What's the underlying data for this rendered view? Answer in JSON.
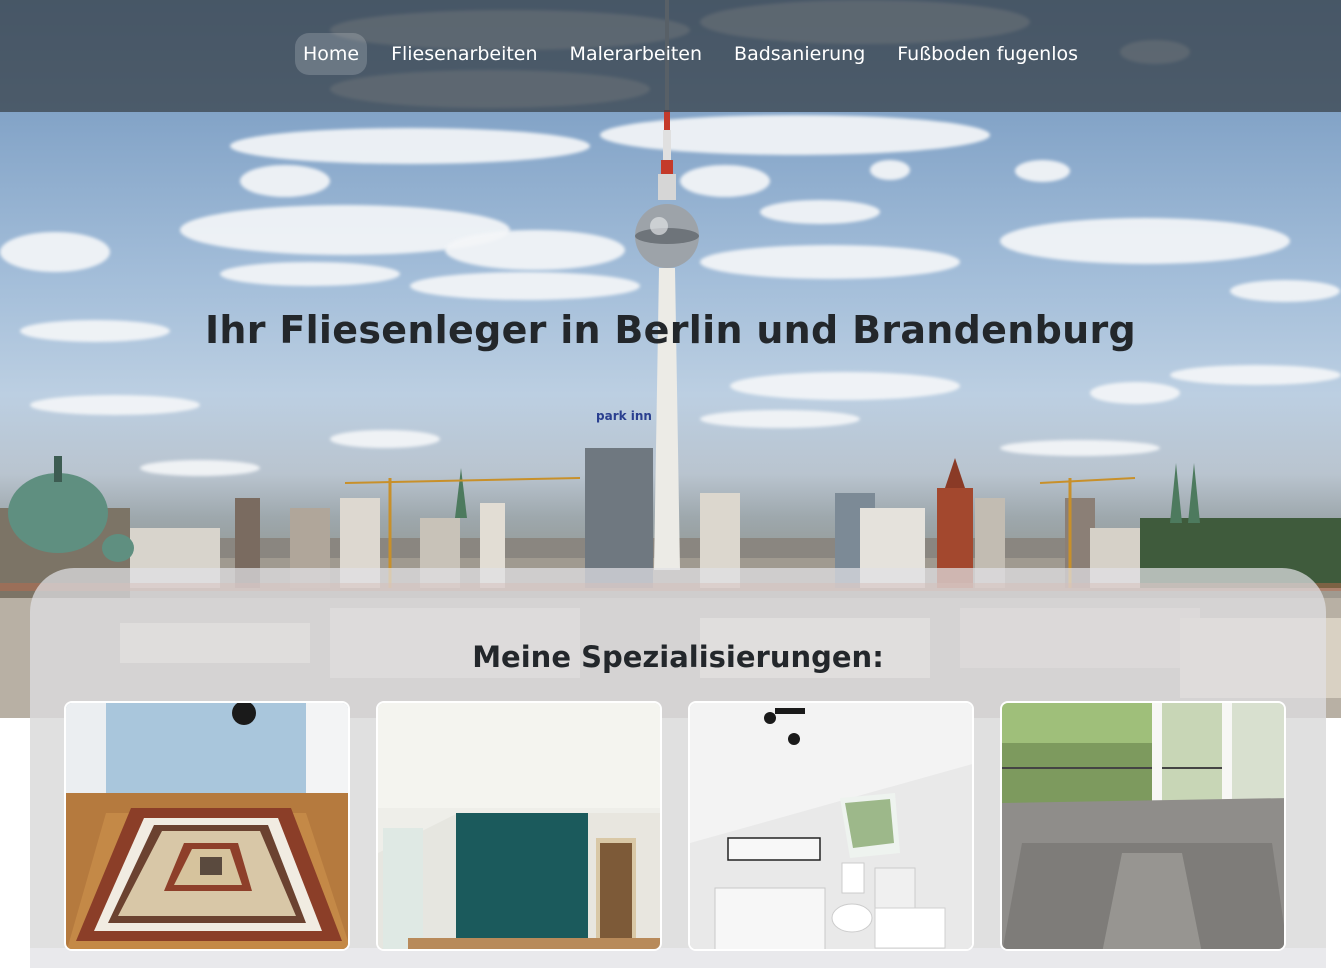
{
  "nav": {
    "items": [
      {
        "label": "Home",
        "active": true
      },
      {
        "label": "Fliesenarbeiten",
        "active": false
      },
      {
        "label": "Malerarbeiten",
        "active": false
      },
      {
        "label": "Badsanierung",
        "active": false
      },
      {
        "label": "Fußboden fugenlos",
        "active": false
      }
    ]
  },
  "hero": {
    "title": "Ihr Fliesenleger in Berlin und Brandenburg",
    "hotel_sign": "park inn"
  },
  "specializations": {
    "title": "Meine Spezialisierungen:",
    "cards": [
      {
        "image": "tiled-floor-mosaic-image"
      },
      {
        "image": "painted-teal-room-image"
      },
      {
        "image": "renovated-bathroom-image"
      },
      {
        "image": "seamless-floor-room-image"
      }
    ]
  },
  "colors": {
    "nav_bg": "#3c4650",
    "panel_bg": "#e1e1e4",
    "title_text": "#23272b",
    "nav_text": "#ffffff"
  }
}
